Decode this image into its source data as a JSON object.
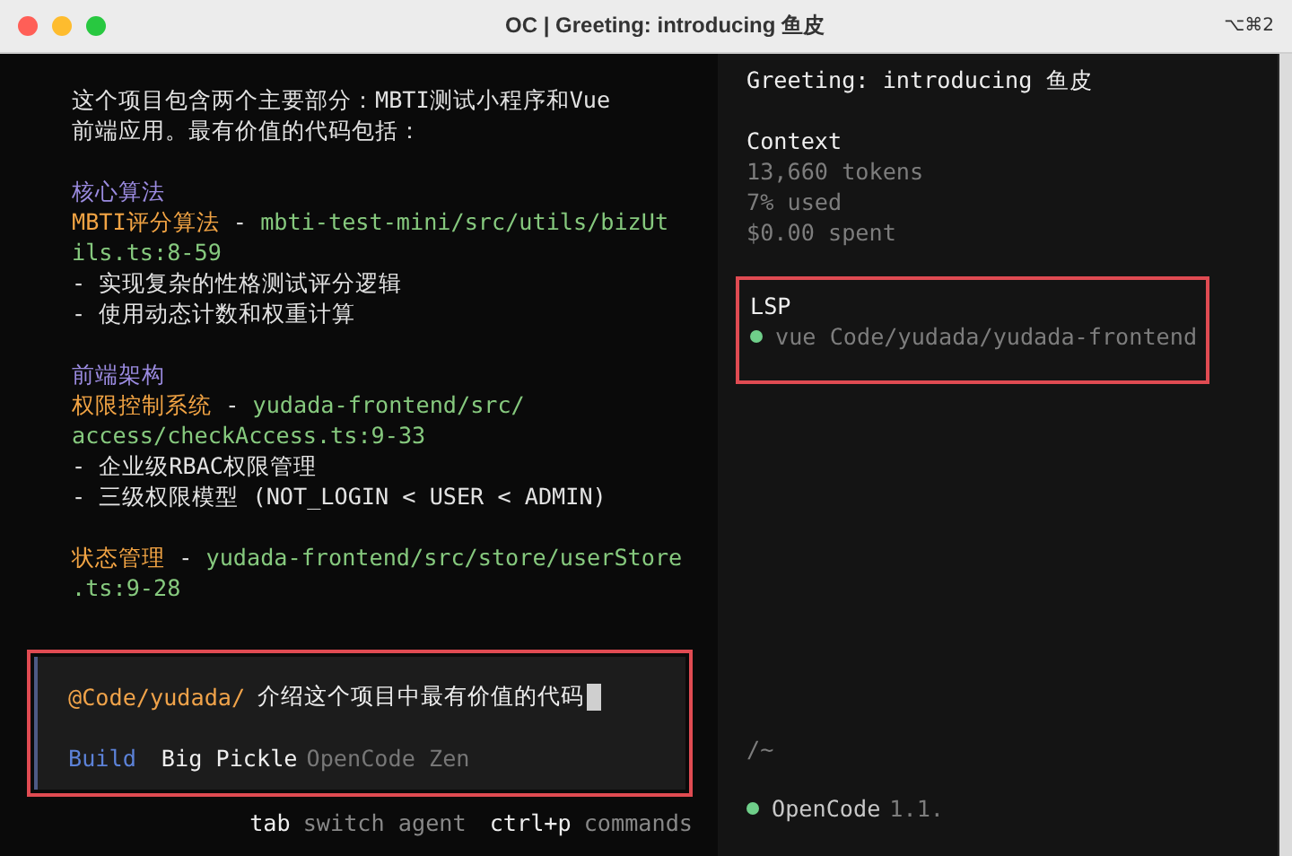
{
  "window": {
    "title": "OC | Greeting: introducing 鱼皮",
    "shortcut": "⌥⌘2"
  },
  "transcript": [
    {
      "lines": [
        [
          {
            "kind": "text",
            "text": "这个项目包含两个主要部分：MBTI测试小程序和Vue"
          }
        ],
        [
          {
            "kind": "text",
            "text": "前端应用。最有价值的代码包括："
          }
        ]
      ]
    },
    {
      "lines": [
        [
          {
            "kind": "heading",
            "text": "核心算法"
          }
        ],
        [
          {
            "kind": "title",
            "text": "MBTI评分算法"
          },
          {
            "kind": "text",
            "text": " - "
          },
          {
            "kind": "path",
            "text": "mbti-test-mini/src/utils/bizUt"
          }
        ],
        [
          {
            "kind": "path",
            "text": "ils.ts:8-59"
          }
        ],
        [
          {
            "kind": "text",
            "text": "- 实现复杂的性格测试评分逻辑"
          }
        ],
        [
          {
            "kind": "text",
            "text": "- 使用动态计数和权重计算"
          }
        ]
      ]
    },
    {
      "lines": [
        [
          {
            "kind": "heading",
            "text": "前端架构"
          }
        ],
        [
          {
            "kind": "title",
            "text": "权限控制系统"
          },
          {
            "kind": "text",
            "text": " - "
          },
          {
            "kind": "path",
            "text": "yudada-frontend/src/"
          }
        ],
        [
          {
            "kind": "path",
            "text": "access/checkAccess.ts:9-33"
          }
        ],
        [
          {
            "kind": "text",
            "text": "- 企业级RBAC权限管理"
          }
        ],
        [
          {
            "kind": "text",
            "text": "- 三级权限模型 (NOT_LOGIN < USER < ADMIN)"
          }
        ]
      ]
    },
    {
      "lines": [
        [
          {
            "kind": "title",
            "text": "状态管理"
          },
          {
            "kind": "text",
            "text": " - "
          },
          {
            "kind": "path",
            "text": "yudada-frontend/src/store/userStore"
          }
        ],
        [
          {
            "kind": "path",
            "text": ".ts:9-28"
          }
        ]
      ]
    }
  ],
  "prompt": {
    "highlighted": true,
    "mention": "@Code/yudada/",
    "text": "介绍这个项目中最有价值的代码",
    "agent": "Build",
    "model": "Big Pickle",
    "provider": "OpenCode Zen"
  },
  "hints": [
    {
      "key": "tab",
      "label": "switch agent"
    },
    {
      "key": "ctrl+p",
      "label": "commands"
    }
  ],
  "sidebar": {
    "title": "Greeting: introducing 鱼皮",
    "context": {
      "heading": "Context",
      "lines": [
        "13,660 tokens",
        "7% used",
        "$0.00 spent"
      ]
    },
    "lsp": {
      "highlighted": true,
      "heading": "LSP",
      "servers": [
        {
          "name": "vue Code/yudada/yudada-frontend",
          "color": "#6fcf8a"
        }
      ]
    },
    "path": "/~",
    "status": {
      "label": "OpenCode",
      "version": "1.1.",
      "color": "#6fcf8a"
    }
  }
}
